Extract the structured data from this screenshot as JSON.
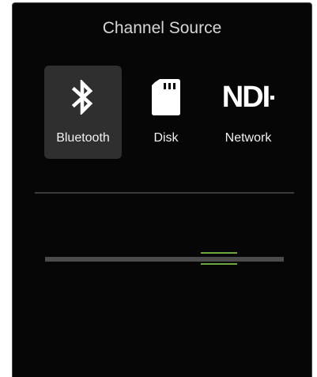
{
  "header": {
    "title": "Channel Source"
  },
  "sources": [
    {
      "label": "Bluetooth",
      "icon": "bluetooth-icon",
      "selected": true
    },
    {
      "label": "Disk",
      "icon": "sd-card-icon",
      "selected": false
    },
    {
      "label": "Network",
      "icon": "ndi-logo",
      "logo_text": "NDI",
      "selected": false
    }
  ],
  "fader": {
    "level": 0.73
  },
  "colors": {
    "panel_background": "#060606",
    "selected_tile": "#2f2f2f",
    "accent_green": "#6fa840",
    "track": "#4b4b4b",
    "text": "#f2f2f2"
  }
}
